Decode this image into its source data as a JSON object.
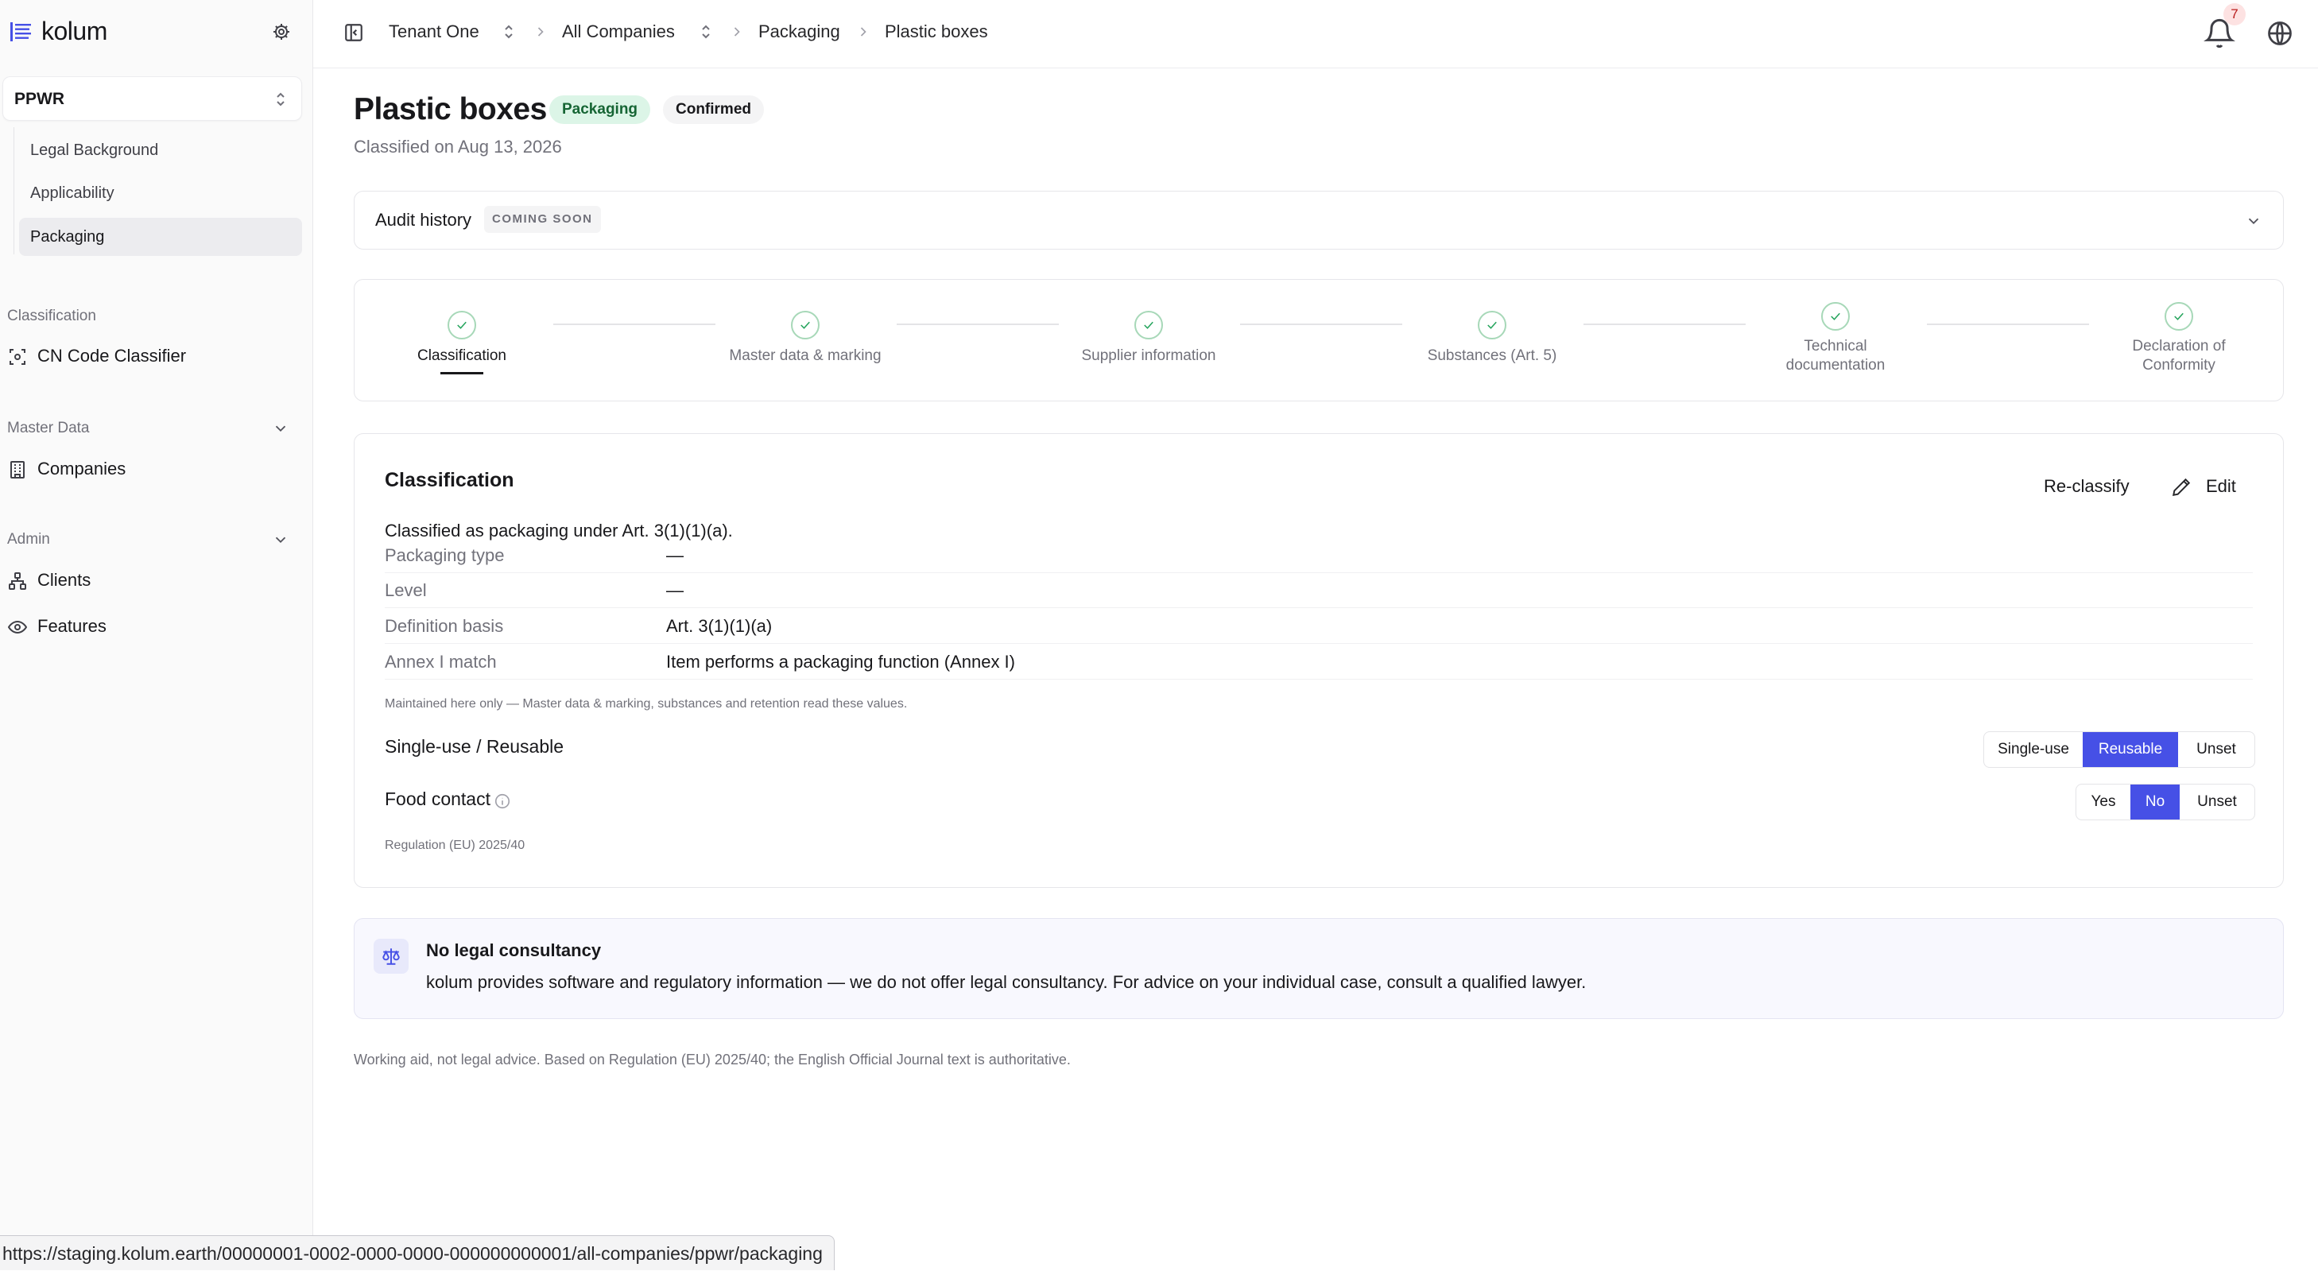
{
  "app": {
    "logo_text": "kolum"
  },
  "sidebar": {
    "module": "PPWR",
    "sub_items": [
      {
        "label": "Legal Background",
        "active": false
      },
      {
        "label": "Applicability",
        "active": false
      },
      {
        "label": "Packaging",
        "active": true
      }
    ],
    "sections": [
      {
        "label": "Classification",
        "items": [
          {
            "label": "CN Code Classifier",
            "icon": "scan-icon"
          }
        ]
      },
      {
        "label": "Master Data",
        "items": [
          {
            "label": "Companies",
            "icon": "building-icon"
          }
        ]
      },
      {
        "label": "Admin",
        "items": [
          {
            "label": "Clients",
            "icon": "network-icon"
          },
          {
            "label": "Features",
            "icon": "eye-icon"
          }
        ]
      }
    ]
  },
  "topbar": {
    "breadcrumbs": [
      "Tenant One",
      "All Companies",
      "Packaging",
      "Plastic boxes"
    ],
    "notification_count": "7"
  },
  "page": {
    "title": "Plastic boxes",
    "badges": {
      "category": "Packaging",
      "status": "Confirmed"
    },
    "subtitle": "Classified on Aug 13, 2026"
  },
  "audit": {
    "label": "Audit history",
    "badge": "COMING SOON"
  },
  "steps": [
    {
      "label": "Classification",
      "done": true,
      "active": true
    },
    {
      "label": "Master data & marking",
      "done": true,
      "active": false
    },
    {
      "label": "Supplier information",
      "done": true,
      "active": false
    },
    {
      "label": "Substances (Art. 5)",
      "done": true,
      "active": false
    },
    {
      "label": "Technical documentation",
      "line1": "Technical",
      "line2": "documentation",
      "done": true,
      "active": false
    },
    {
      "label": "Declaration of Conformity",
      "line1": "Declaration of",
      "line2": "Conformity",
      "done": true,
      "active": false
    }
  ],
  "classification": {
    "title": "Classification",
    "reclassify_label": "Re-classify",
    "edit_label": "Edit",
    "summary": "Classified as packaging under Art. 3(1)(1)(a).",
    "fields": [
      {
        "key": "Packaging type",
        "value": "—"
      },
      {
        "key": "Level",
        "value": "—"
      },
      {
        "key": "Definition basis",
        "value": "Art. 3(1)(1)(a)"
      },
      {
        "key": "Annex I match",
        "value": "Item performs a packaging function (Annex I)"
      }
    ],
    "note": "Maintained here only — Master data & marking, substances and retention read these values.",
    "single_use": {
      "label": "Single-use / Reusable",
      "options": [
        "Single-use",
        "Reusable",
        "Unset"
      ],
      "selected": "Reusable"
    },
    "food_contact": {
      "label": "Food contact",
      "options": [
        "Yes",
        "No",
        "Unset"
      ],
      "selected": "No"
    },
    "regulation": "Regulation (EU) 2025/40"
  },
  "disclaimer": {
    "title": "No legal consultancy",
    "text": "kolum provides software and regulatory information — we do not offer legal consultancy. For advice on your individual case, consult a qualified lawyer."
  },
  "footer": "Working aid, not legal advice. Based on Regulation (EU) 2025/40; the English Official Journal text is authoritative.",
  "status_bar_url": "https://staging.kolum.earth/00000001-0002-0000-0000-000000000001/all-companies/ppwr/packaging",
  "colors": {
    "accent": "#4650e6",
    "success": "#22a35a",
    "badge_green_bg": "#dcf5e7"
  }
}
